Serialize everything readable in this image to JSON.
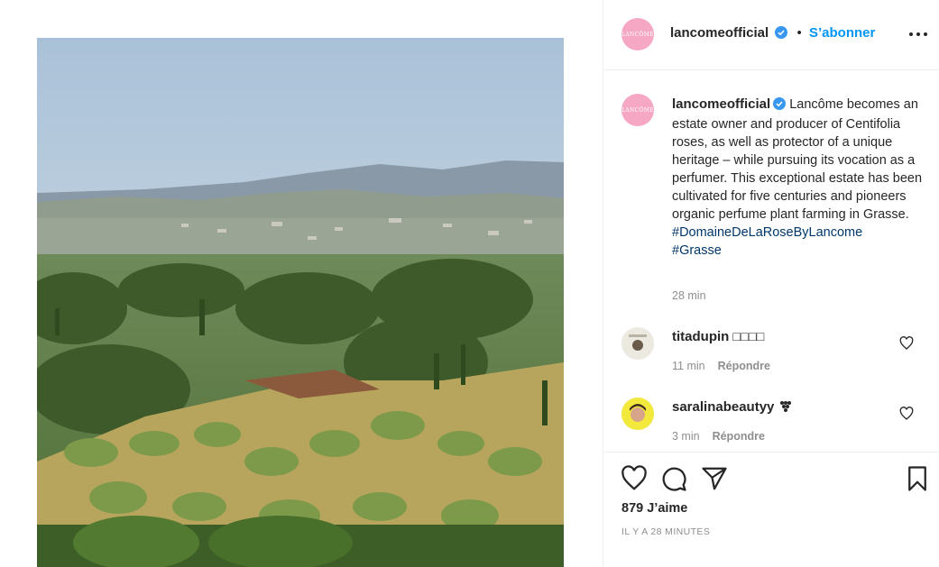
{
  "post": {
    "author": "lancomeofficial",
    "avatar_text": "LANCÔME",
    "follow_label": "S’abonner",
    "separator": "•",
    "caption_text": "Lancôme becomes an estate owner and producer of Centifolia roses, as well as protector of a unique heritage – while pursuing its vocation as a perfumer. This exceptional estate has been cultivated for five centuries and pioneers organic perfume plant farming in Grasse.",
    "hashtags": [
      "#DomaineDeLaRoseByLancome",
      "#Grasse"
    ],
    "caption_time": "28 min"
  },
  "comments": [
    {
      "user": "titadupin",
      "text": "□□□□",
      "time": "11 min",
      "reply_label": "Répondre"
    },
    {
      "user": "saralinabeautyy",
      "text": "",
      "time": "3 min",
      "reply_label": "Répondre"
    }
  ],
  "footer": {
    "likes": "879 J’aime",
    "timestamp": "IL Y A 28 MINUTES"
  },
  "colors": {
    "accent": "#0095f6",
    "hashtag": "#00376b",
    "avatar_pink": "#f5a7c3",
    "muted": "#8e8e8e"
  },
  "icons": [
    "verified-badge-icon",
    "more-options-icon",
    "heart-icon",
    "comment-icon",
    "share-icon",
    "bookmark-icon"
  ]
}
